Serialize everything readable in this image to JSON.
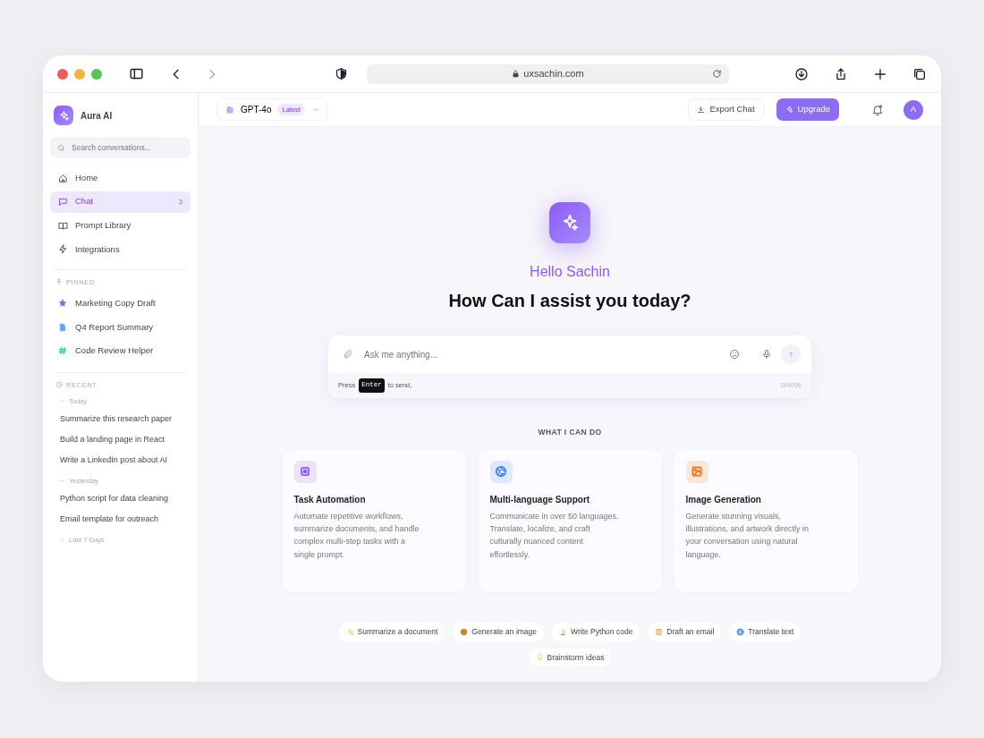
{
  "browser": {
    "url": "uxsachin.com"
  },
  "sidebar": {
    "brand": "Aura AI",
    "search": {
      "placeholder": "Search conversations..."
    },
    "nav": [
      {
        "label": "Home",
        "selected": false
      },
      {
        "label": "Chat",
        "selected": true,
        "badge": "3"
      },
      {
        "label": "Prompt Library",
        "selected": false
      },
      {
        "label": "Integrations",
        "selected": false
      }
    ],
    "pinned": {
      "heading": "PINNED",
      "items": [
        {
          "label": "Marketing Copy Draft",
          "color": "#8b5cf6"
        },
        {
          "label": "Q4 Report Summary",
          "color": "#60a5fa"
        },
        {
          "label": "Code Review Helper",
          "color": "#34d399"
        }
      ]
    },
    "recent": {
      "heading": "RECENT",
      "groups": [
        {
          "label": "Today",
          "expanded": true,
          "items": [
            "Summarize this research paper",
            "Build a landing page in React",
            "Write a LinkedIn post about AI"
          ]
        },
        {
          "label": "Yesterday",
          "expanded": true,
          "items": [
            "Python script for data cleaning",
            "Email template for outreach"
          ]
        },
        {
          "label": "Last 7 Days",
          "expanded": false
        }
      ]
    }
  },
  "topbar": {
    "model": "GPT-4o",
    "model_tag": "Latest",
    "export": "Export Chat",
    "upgrade": "Upgrade",
    "notification": true,
    "avatar": "A"
  },
  "hero": {
    "greeting": "Hello Sachin",
    "title": "How Can I assist you today?"
  },
  "composer": {
    "placeholder": "Ask me anything...",
    "hint_before": "Press",
    "key": "Enter",
    "hint_after": "to send,",
    "counter": "0/4096"
  },
  "capabilities": {
    "heading": "WHAT I CAN DO",
    "cards": [
      {
        "title": "Task Automation",
        "text": "Automate repetitive workflows, summarize documents, and handle complex multi-step tasks with a single prompt.",
        "color": "#8b5cf6"
      },
      {
        "title": "Multi-language Support",
        "text": "Communicate in over 50 languages. Translate, localize, and craft culturally nuanced content effortlessly.",
        "color": "#3b82f6"
      },
      {
        "title": "Image Generation",
        "text": "Generate stunning visuals, illustrations, and artwork directly in your conversation using natural language.",
        "color": "#f97316"
      }
    ]
  },
  "suggestions": [
    "Summarize a document",
    "Generate an image",
    "Write Python code",
    "Draft an email",
    "Translate text",
    "Brainstorm ideas"
  ]
}
